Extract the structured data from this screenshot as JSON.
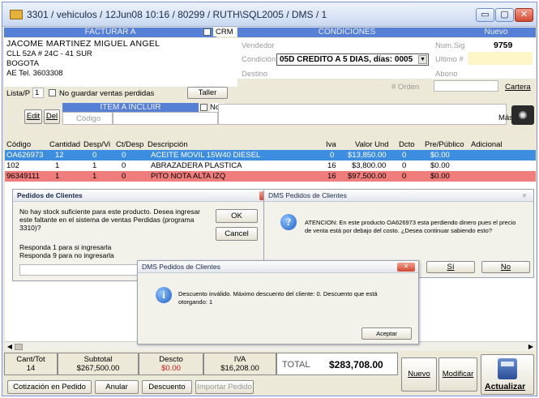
{
  "window": {
    "title": "3301 / vehiculos / 12Jun08 10:16 / 80299 / RUTH\\SQL2005 / DMS / 1",
    "min_label": "▭",
    "max_label": "▢",
    "close_label": "✕"
  },
  "header": {
    "facturar_label": "FACTURAR A",
    "crm_label": "CRM",
    "condiciones_label": "CONDICIONES",
    "nuevo_label": "Nuevo"
  },
  "customer": {
    "name": "JACOME MARTINEZ MIGUEL ANGEL",
    "address": "CLL 52A # 24C - 41 SUR",
    "city": "BOGOTA",
    "phone": "AE  Tel. 3603308"
  },
  "conditions": {
    "vendedor_label": "Vendedor",
    "condicion_label": "Condición",
    "condicion_value": "05D CREDITO A 5 DIAS, días: 0005",
    "destino_label": "Destino",
    "num_sig_label": "Num.Sig",
    "num_sig_value": "9759",
    "ultimo_label": "Ultimo #",
    "abono_label": "Abono",
    "orden_label": "# Orden",
    "cartera_label": "Cartera"
  },
  "options": {
    "lista_label": "Lista/P",
    "lista_value": "1",
    "no_guardar_label": "No guardar ventas perdidas",
    "taller_label": "Taller"
  },
  "item_bar": {
    "edit_label": "Edit",
    "del_label": "Del",
    "item_incluir_label": "ITEM A INCLUIR",
    "codigo_placeholder": "Código",
    "no_label": "No",
    "mas_label": "Más"
  },
  "grid": {
    "columns": [
      "Código",
      "Cantidad",
      "Desp/Vi",
      "Ct/Desp",
      "Descripción",
      "Iva",
      "Valor Und",
      "Dcto",
      "Pre/Público",
      "Adicional"
    ],
    "rows": [
      {
        "codigo": "OA626973",
        "cantidad": "12",
        "desp": "0",
        "ct": "0",
        "descripcion": "ACEITE MOVIL 15W40 DIESEL",
        "iva": "0",
        "valor": "$13,850.00",
        "dcto": "0",
        "pre": "$0.00"
      },
      {
        "codigo": "102",
        "cantidad": "1",
        "desp": "1",
        "ct": "0",
        "descripcion": "ABRAZADERA PLASTICA",
        "iva": "16",
        "valor": "$3,800.00",
        "dcto": "0",
        "pre": "$0.00"
      },
      {
        "codigo": "96349111",
        "cantidad": "1",
        "desp": "1",
        "ct": "0",
        "descripcion": "PITO NOTA ALTA IZQ",
        "iva": "16",
        "valor": "$97,500.00",
        "dcto": "0",
        "pre": "$0.00"
      }
    ]
  },
  "dialog_pedidos": {
    "title": "Pedidos de Clientes",
    "message": "No hay stock suficiente para este producto. Desea ingresar este faltante en el sistema de ventas Perdidas (programa 3310)?",
    "line1": "Responda 1 para si ingresarla",
    "line2": "Responda 9 para no ingresarla",
    "ok_label": "OK",
    "cancel_label": "Cancel"
  },
  "dialog_dms": {
    "title": "DMS Pedidos de Clientes",
    "message": "ATENCION: En este producto OA626973 esta perdiendo dinero pues el precio de venta está por debajo del costo. ¿Desea continuar sabiendo esto?",
    "si_label": "Sí",
    "no_label": "No"
  },
  "dialog_descuento": {
    "title": "DMS Pedidos de Clientes",
    "message": "Descuento inválido. Máximo descuento del cliente: 0. Descuento que está otorgando: 1",
    "accept_label": "Aceptar"
  },
  "totals": {
    "cant_label": "Cant/Tot",
    "cant_value": "14",
    "subtotal_label": "Subtotal",
    "subtotal_value": "$267,500.00",
    "descto_label": "Descto",
    "descto_value": "$0.00",
    "iva_label": "IVA",
    "iva_value": "$16,208.00",
    "total_label": "TOTAL",
    "total_value": "$283,708.00"
  },
  "actions": {
    "cotizacion_label": "Cotización en Pedido",
    "anular_label": "Anular",
    "descuento_label": "Descuento",
    "importar_label": "Importar Pedido",
    "nuevo_label": "Nuevo",
    "modificar_label": "Modificar",
    "actualizar_label": "Actualizar"
  },
  "colors": {
    "accent": "#5580d6",
    "selected_row": "#3d8ee0",
    "alert_row": "#ee7d7b"
  }
}
